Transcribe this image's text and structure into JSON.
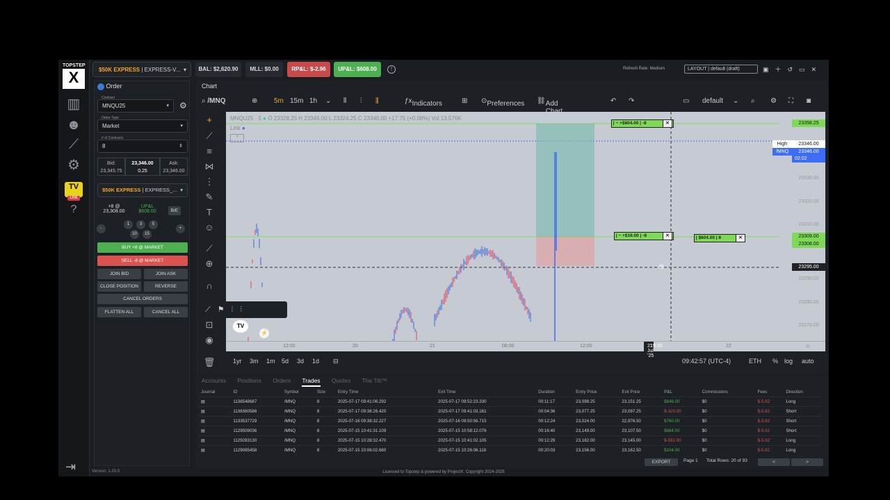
{
  "brand": {
    "line1": "TOPSTEP",
    "mark": "X"
  },
  "tv_badge": {
    "label": "TV",
    "live": "LIVE"
  },
  "version": "Version: 1.20.0",
  "topbar": {
    "account": "$50K EXPRESS",
    "account_suffix": "| EXPRESS-V...",
    "balance": "BAL: $2,620.90",
    "mll": "MLL: $0.00",
    "rpl": "RP&L: $-2.96",
    "upl": "UP&L: $608.00",
    "refresh_rate": "Refresh Rate: Medium",
    "layout": "LAYOUT | default (draft)"
  },
  "order": {
    "tab": "Order",
    "contract_label": "Contract",
    "contract": "MNQU25",
    "order_type_label": "Order Type",
    "order_type": "Market",
    "contracts_label": "# of Contracts",
    "contracts": "8",
    "bid_label": "Bid:",
    "bid": "23,345.75",
    "last": "23,346.00",
    "spread": "0.25",
    "ask_label": "Ask:",
    "ask": "23,346.00",
    "account": "$50K EXPRESS",
    "account_suffix": "| EXPRESS_...",
    "position": "+8 @",
    "position_price": "23,308.00",
    "upl_label": "UP&L",
    "upl_value": "$608.00",
    "be": "B/E",
    "minus": "-",
    "plus": "+",
    "qty": [
      "1",
      "3",
      "5",
      "10",
      "15"
    ],
    "buy": "BUY +8 @ MARKET",
    "sell": "SELL -8 @ MARKET",
    "join_bid": "JOIN BID",
    "join_ask": "JOIN ASK",
    "close_position": "CLOSE POSITION",
    "reverse_position": "REVERSE POSITION",
    "cancel_orders": "CANCEL ORDERS",
    "flatten_all": "FLATTEN ALL",
    "cancel_all": "CANCEL ALL"
  },
  "chart": {
    "tab": "Chart",
    "symbol": "/MNQ",
    "intervals": [
      "5m",
      "15m",
      "1h"
    ],
    "indicators": "Indicators",
    "preferences": "Preferences",
    "add_chart_link": "Add Chart Link",
    "layout_name": "default",
    "legend_symbol": "MNQU25",
    "legend_interval": "5",
    "legend_o": "O",
    "legend_o_val": "23328.25",
    "legend_h": "H",
    "legend_h_val": "23346.00",
    "legend_l": "L",
    "legend_l_val": "23324.25",
    "legend_c": "C",
    "legend_c_val": "23346.00",
    "legend_change": "+17.75 (+0.08%)",
    "legend_vol": "Vol",
    "legend_vol_val": "13.576K",
    "link": "Link",
    "price_labels": {
      "tp": "23358.25",
      "high_label": "High",
      "high": "23346.00",
      "sym_tag": "/MNQ",
      "last": "23346.00",
      "countdown": "02:02",
      "entry_a": "23309.00",
      "entry_b": "23308.00",
      "cursor": "23295.00"
    },
    "scale_ticks": [
      "23330.00",
      "23320.00",
      "23310.00",
      "23300.00",
      "23290.00",
      "23280.00",
      "23270.00"
    ],
    "order_tags": {
      "tp": "+$804.00",
      "tp_qty": "-8",
      "sl": "+$16.00",
      "sl_qty": "-8",
      "pos": "$604.00",
      "pos_qty": "8"
    },
    "x_ticks": [
      "12:00",
      "20",
      "21",
      "06:00",
      "12:00",
      "22"
    ],
    "cursor_date": "21 Jul '25",
    "cursor_time": "19:35",
    "ranges": [
      "1yr",
      "3m",
      "1m",
      "5d",
      "3d",
      "1d"
    ],
    "clock": "09:42:57 (UTC-4)",
    "session": "ETH",
    "pct": "%",
    "log": "log",
    "auto": "auto"
  },
  "bottom": {
    "tabs": [
      "Accounts",
      "Positions",
      "Orders",
      "Trades",
      "Quotes",
      "The Tilt™"
    ],
    "columns": [
      "Journal",
      "ID",
      "Symbol",
      "Size",
      "Entry Time",
      "Exit Time",
      "Duration",
      "Entry Price",
      "Exit Price",
      "P&L",
      "Commissions",
      "Fees",
      "Direction"
    ],
    "rows": [
      {
        "id": "1138548687",
        "symbol": "/MNQ",
        "size": "8",
        "entry_time": "2025-07-17 09:41:06.292",
        "exit_time": "2025-07-17 09:52:23.330",
        "duration": "00:11:17",
        "entry_price": "23,098.25",
        "exit_price": "23,151.25",
        "pnl": "$848.00",
        "comm": "$0",
        "fees": "$-5.92",
        "dir": "Long"
      },
      {
        "id": "1138360586",
        "symbol": "/MNQ",
        "size": "8",
        "entry_time": "2025-07-17 09:36:26.420",
        "exit_time": "2025-07-17 09:41:03.161",
        "duration": "00:04:36",
        "entry_price": "23,077.25",
        "exit_price": "23,097.25",
        "pnl": "$-320.00",
        "comm": "$0",
        "fees": "$-5.92",
        "dir": "Short"
      },
      {
        "id": "1133537729",
        "symbol": "/MNQ",
        "size": "8",
        "entry_time": "2025-07-16 09:38:32.227",
        "exit_time": "2025-07-16 09:50:56.715",
        "duration": "00:12:24",
        "entry_price": "23,024.00",
        "exit_price": "22,976.50",
        "pnl": "$760.00",
        "comm": "$0",
        "fees": "$-5.92",
        "dir": "Short"
      },
      {
        "id": "1129509036",
        "symbol": "/MNQ",
        "size": "8",
        "entry_time": "2025-07-15 10:41:31.109",
        "exit_time": "2025-07-15 10:58:12.076",
        "duration": "00:16:40",
        "entry_price": "23,149.00",
        "exit_price": "23,107.50",
        "pnl": "$664.00",
        "comm": "$0",
        "fees": "$-5.92",
        "dir": "Short"
      },
      {
        "id": "1129283130",
        "symbol": "/MNQ",
        "size": "8",
        "entry_time": "2025-07-15 10:28:32.470",
        "exit_time": "2025-07-15 10:41:02.105",
        "duration": "00:12:29",
        "entry_price": "23,182.00",
        "exit_price": "23,145.00",
        "pnl": "$-592.00",
        "comm": "$0",
        "fees": "$-5.92",
        "dir": "Long"
      },
      {
        "id": "1129085458",
        "symbol": "/MNQ",
        "size": "8",
        "entry_time": "2025-07-15 10:06:02.680",
        "exit_time": "2025-07-15 10:26:06.118",
        "duration": "00:20:03",
        "entry_price": "23,156.00",
        "exit_price": "23,162.50",
        "pnl": "$104.00",
        "comm": "$0",
        "fees": "$-5.92",
        "dir": "Long"
      }
    ],
    "export": "EXPORT",
    "page": "Page 1",
    "total_rows": "Total Rows: 20 of 93",
    "prev": "<",
    "next": ">"
  },
  "footer": "Licensed to Topstep & powered by ProjectX. Copyright 2024-2025",
  "colors": {
    "accent": "#f5a623",
    "buy": "#4caf50",
    "sell": "#d9534f",
    "price_line": "#3d6cf5"
  }
}
